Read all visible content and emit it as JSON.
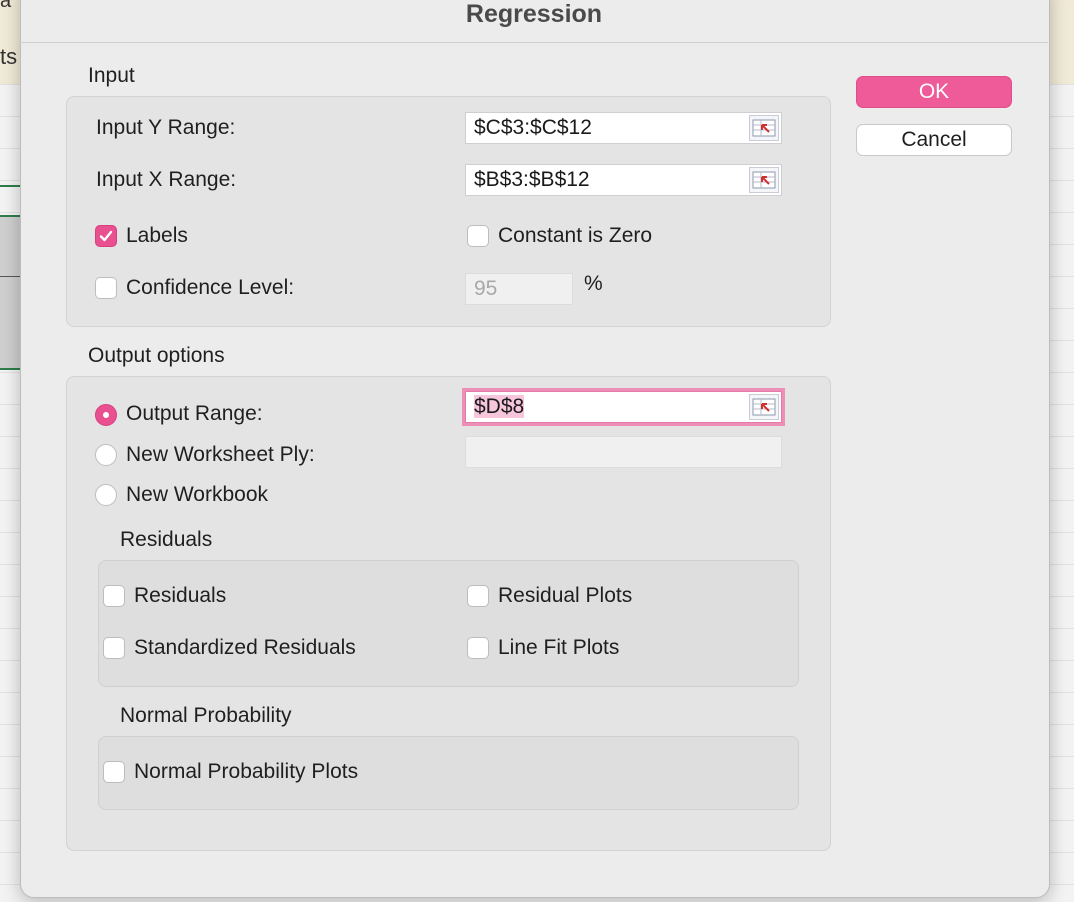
{
  "background": {
    "ribbon_text": "ts",
    "top_text": "a"
  },
  "dialog": {
    "title": "Regression",
    "buttons": {
      "ok": "OK",
      "cancel": "Cancel"
    },
    "input": {
      "section_label": "Input",
      "y_range_label": "Input Y Range:",
      "y_range_value": "$C$3:$C$12",
      "x_range_label": "Input X Range:",
      "x_range_value": "$B$3:$B$12",
      "labels_label": "Labels",
      "labels_checked": true,
      "constant_zero_label": "Constant is Zero",
      "constant_zero_checked": false,
      "confidence_label": "Confidence Level:",
      "confidence_checked": false,
      "confidence_value": "95",
      "percent_sign": "%"
    },
    "output": {
      "section_label": "Output options",
      "output_range_label": "Output Range:",
      "output_range_value": "$D$8",
      "new_worksheet_label": "New Worksheet Ply:",
      "new_workbook_label": "New Workbook",
      "selected": "output_range"
    },
    "residuals": {
      "section_label": "Residuals",
      "residuals_label": "Residuals",
      "residual_plots_label": "Residual Plots",
      "standardized_label": "Standardized Residuals",
      "line_fit_label": "Line Fit Plots"
    },
    "normal_probability": {
      "section_label": "Normal Probability",
      "plots_label": "Normal Probability Plots"
    }
  },
  "colors": {
    "accent": "#e8508f",
    "ok_button": "#ee5b98"
  },
  "icons": {
    "range_selector": "range-select-icon",
    "check": "checkmark-icon"
  }
}
